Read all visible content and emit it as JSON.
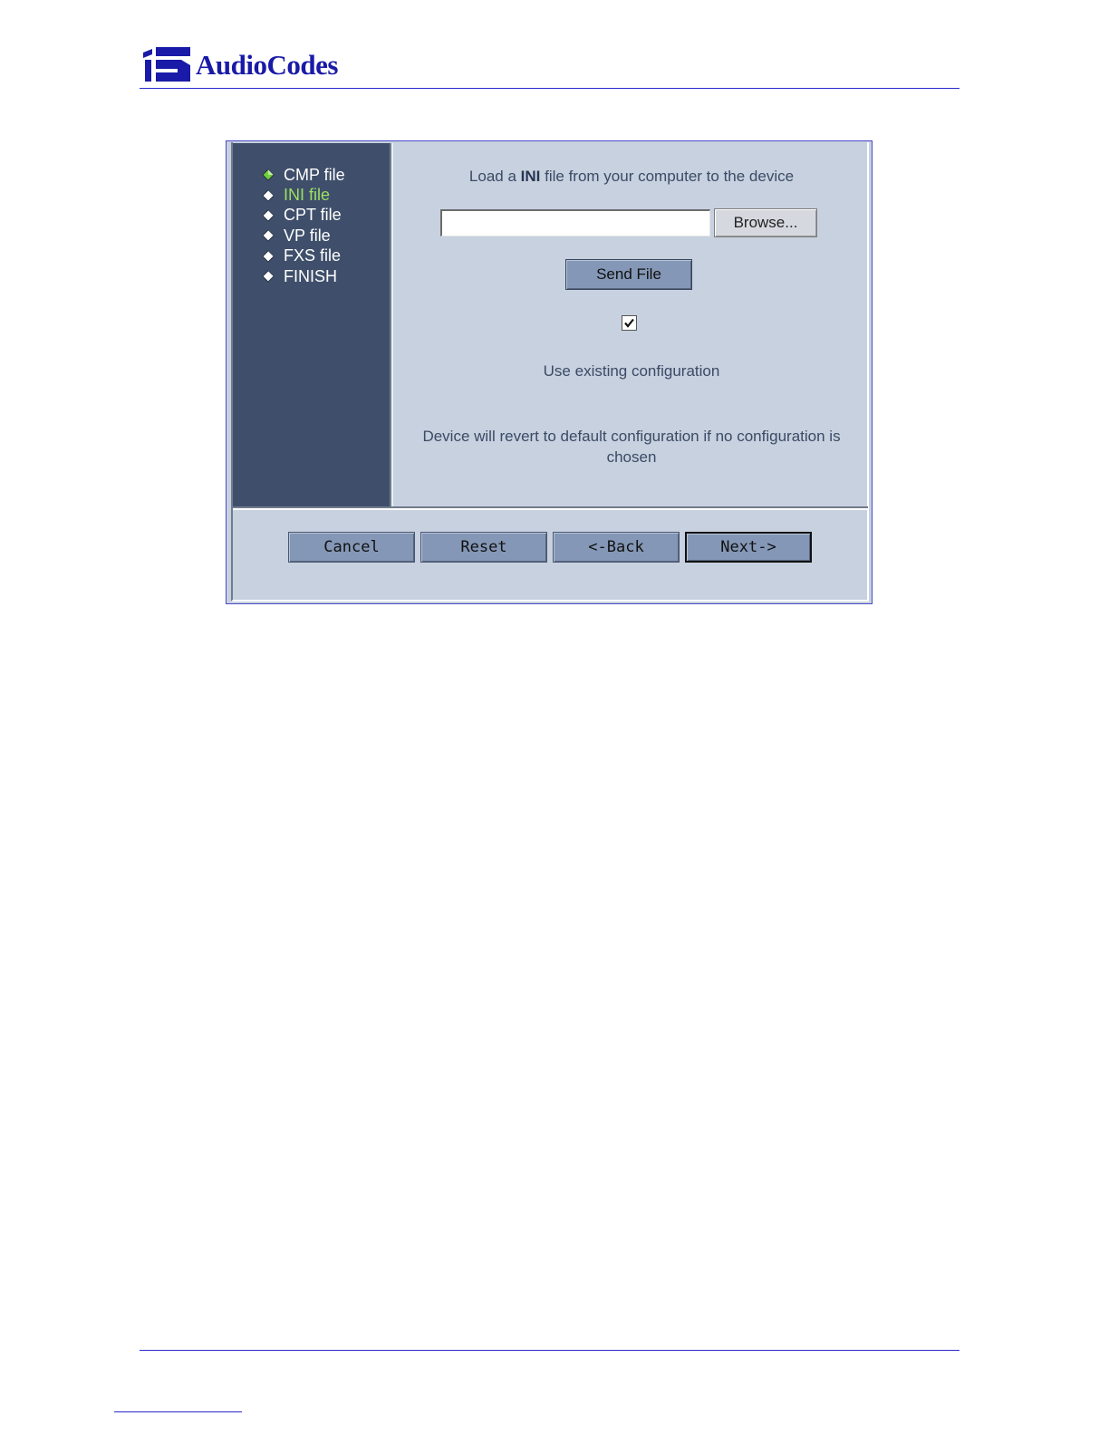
{
  "header": {
    "logo_text": "AudioCodes"
  },
  "wizard": {
    "nav": [
      {
        "label": "CMP file",
        "bullet_color": "#6fcf3a"
      },
      {
        "label": "INI file",
        "bullet_color": "#ffffff",
        "active": true
      },
      {
        "label": "CPT file",
        "bullet_color": "#ffffff"
      },
      {
        "label": "VP file",
        "bullet_color": "#ffffff"
      },
      {
        "label": "FXS file",
        "bullet_color": "#ffffff"
      },
      {
        "label": "FINISH",
        "bullet_color": "#ffffff"
      }
    ],
    "instruction_prefix": "Load a",
    "instruction_bold": "INI",
    "instruction_suffix": "file from your computer to the device",
    "file_input_value": "",
    "browse_label": "Browse...",
    "send_label": "Send File",
    "use_existing_checked": true,
    "use_existing_label": "Use existing configuration",
    "revert_note": "Device will revert to default configuration if no configuration is chosen",
    "buttons": {
      "cancel": "Cancel",
      "reset": "Reset",
      "back": "<-Back",
      "next": "Next->"
    }
  },
  "colors": {
    "brand_blue": "#1a1aa8",
    "sidebar_bg": "#3f4f6b",
    "panel_bg": "#c7d1df",
    "button_bg": "#8497b6",
    "active_nav": "#9be060"
  }
}
